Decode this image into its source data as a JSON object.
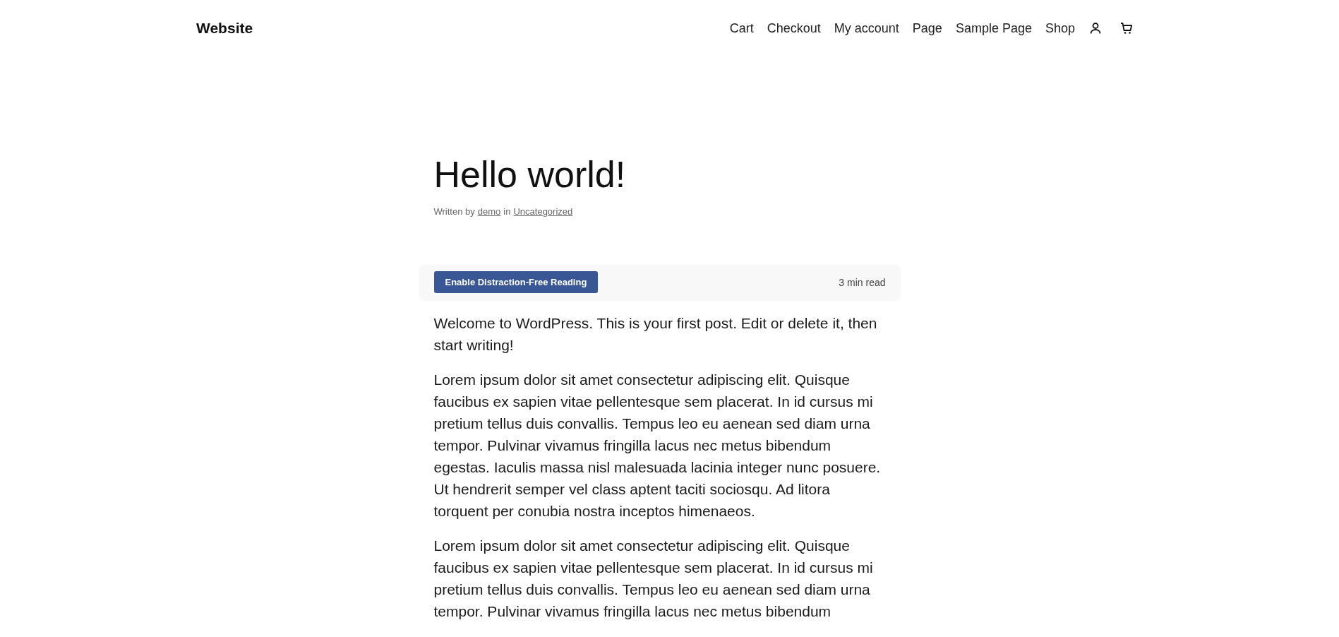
{
  "site_title": "Website",
  "nav": [
    {
      "label": "Cart"
    },
    {
      "label": "Checkout"
    },
    {
      "label": "My account"
    },
    {
      "label": "Page"
    },
    {
      "label": "Sample Page"
    },
    {
      "label": "Shop"
    }
  ],
  "post": {
    "title": "Hello world!",
    "meta": {
      "prefix": "Written by",
      "author": "demo",
      "joiner": "in",
      "category": "Uncategorized"
    },
    "reading_bar": {
      "button": "Enable Distraction-Free Reading",
      "read_time": "3 min read"
    },
    "paragraphs": [
      "Welcome to WordPress. This is your first post. Edit or delete it, then start writing!",
      "Lorem ipsum dolor sit amet consectetur adipiscing elit. Quisque faucibus ex sapien vitae pellentesque sem placerat. In id cursus mi pretium tellus duis convallis. Tempus leo eu aenean sed diam urna tempor. Pulvinar vivamus fringilla lacus nec metus bibendum egestas. Iaculis massa nisl malesuada lacinia integer nunc posuere. Ut hendrerit semper vel class aptent taciti sociosqu. Ad litora torquent per conubia nostra inceptos himenaeos.",
      "Lorem ipsum dolor sit amet consectetur adipiscing elit. Quisque faucibus ex sapien vitae pellentesque sem placerat. In id cursus mi pretium tellus duis convallis. Tempus leo eu aenean sed diam urna tempor. Pulvinar vivamus fringilla lacus nec metus bibendum"
    ]
  }
}
